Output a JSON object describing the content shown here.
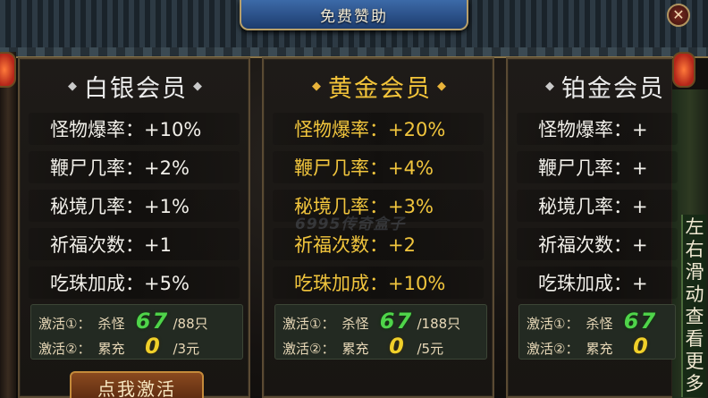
{
  "header": {
    "title": "免费赞助",
    "close_label": "✕"
  },
  "watermark": "6995传奇盒子",
  "tiers": [
    {
      "name": "白银会员",
      "stats": [
        "怪物爆率：+10%",
        "鞭尸几率：+2%",
        "秘境几率：+1%",
        "祈福次数：+1",
        "吃珠加成：+5%"
      ],
      "act1": {
        "label": "激活①：",
        "cond": "杀怪",
        "current": "67",
        "goal": "/88只"
      },
      "act2": {
        "label": "激活②：",
        "cond": "累充",
        "current": "0",
        "goal": "/3元"
      },
      "button": "点我激活"
    },
    {
      "name": "黄金会员",
      "stats": [
        "怪物爆率：+20%",
        "鞭尸几率：+4%",
        "秘境几率：+3%",
        "祈福次数：+2",
        "吃珠加成：+10%"
      ],
      "act1": {
        "label": "激活①：",
        "cond": "杀怪",
        "current": "67",
        "goal": "/188只"
      },
      "act2": {
        "label": "激活②：",
        "cond": "累充",
        "current": "0",
        "goal": "/5元"
      }
    },
    {
      "name": "铂金会员",
      "stats": [
        "怪物爆率：+",
        "鞭尸几率：+",
        "秘境几率：+",
        "祈福次数：+",
        "吃珠加成：+"
      ],
      "act1": {
        "label": "激活①：",
        "cond": "杀怪",
        "current": "67",
        "goal": ""
      },
      "act2": {
        "label": "激活②：",
        "cond": "累充",
        "current": "0",
        "goal": ""
      }
    }
  ],
  "swipe_hint": "左右滑动查看更多",
  "colors": {
    "gold_text": "#f1c53d",
    "green_count": "#4fd44a",
    "yellow_count": "#f0d02a"
  }
}
